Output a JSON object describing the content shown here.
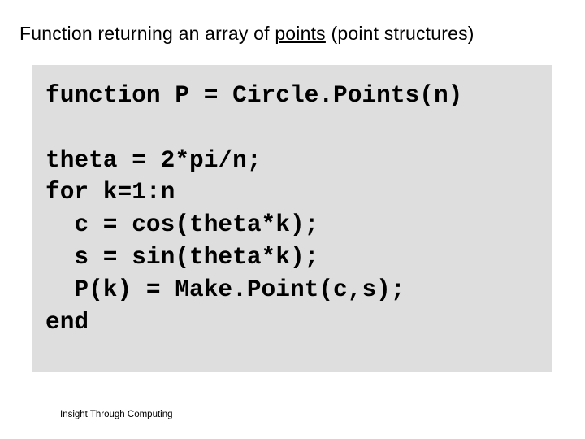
{
  "title": {
    "pre": "Function returning an array of ",
    "points": "points",
    "post": " (point structures)"
  },
  "code": {
    "line1": "function P = Circle.Points(n)",
    "blank": "",
    "line2": "theta = 2*pi/n;",
    "line3": "for k=1:n",
    "line4": "  c = cos(theta*k);",
    "line5": "  s = sin(theta*k);",
    "line6": "  P(k) = Make.Point(c,s);",
    "line7": "end"
  },
  "footer": "Insight Through Computing"
}
